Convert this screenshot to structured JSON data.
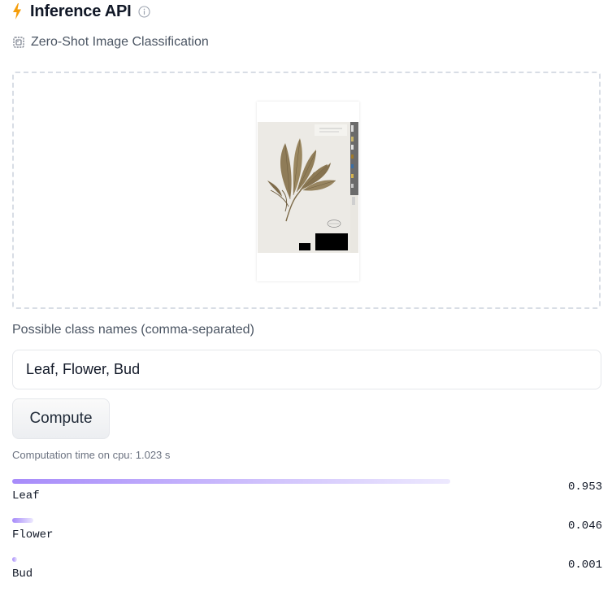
{
  "header": {
    "title": "Inference API",
    "icon": "lightning-bolt-icon",
    "info_icon": "info-icon",
    "accent_color": "#f59e0b"
  },
  "task": {
    "icon": "image-classification-icon",
    "label": "Zero-Shot Image Classification"
  },
  "dropzone": {
    "image_description_icon": "herbarium-specimen-image"
  },
  "class_names": {
    "label": "Possible class names (comma-separated)",
    "value": "Leaf, Flower, Bud"
  },
  "compute_button": {
    "label": "Compute"
  },
  "computation": {
    "text": "Computation time on cpu: 1.023 s"
  },
  "results": [
    {
      "label": "Leaf",
      "score": "0.953",
      "fraction": 0.953
    },
    {
      "label": "Flower",
      "score": "0.046",
      "fraction": 0.046
    },
    {
      "label": "Bud",
      "score": "0.001",
      "fraction": 0.001
    }
  ],
  "colors": {
    "bar_start": "#a78bfa",
    "bar_end": "#ede9fe",
    "dropzone_border": "#d8dde5"
  }
}
